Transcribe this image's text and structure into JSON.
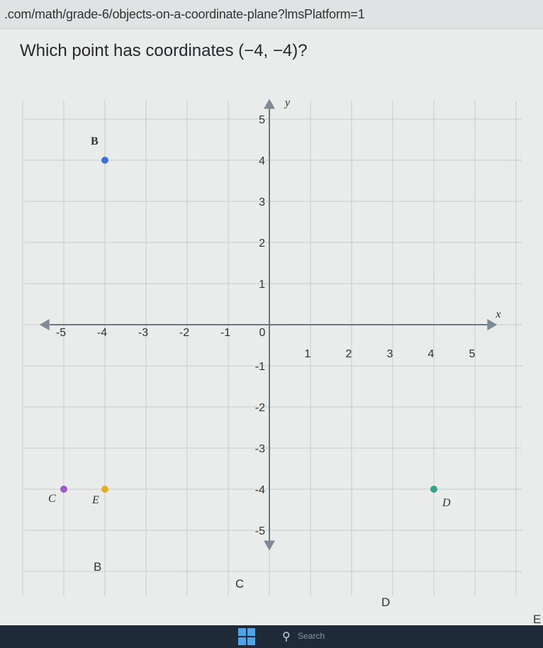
{
  "browser": {
    "url": ".com/math/grade-6/objects-on-a-coordinate-plane?lmsPlatform=1"
  },
  "question": {
    "prefix": "Which point has coordinates ",
    "coords": "(−4, −4)",
    "suffix": "?"
  },
  "plane": {
    "x_axis_label": "x",
    "y_axis_label": "y",
    "x_range": [
      -5,
      5
    ],
    "y_range": [
      -5,
      5
    ],
    "x_ticks": [
      "-5",
      "-4",
      "-3",
      "-2",
      "-1",
      "0",
      "1",
      "2",
      "3",
      "4",
      "5"
    ],
    "y_ticks": [
      "-5",
      "-4",
      "-3",
      "-2",
      "-1",
      "1",
      "2",
      "3",
      "4",
      "5"
    ],
    "points": [
      {
        "label": "B",
        "x": -4,
        "y": 4,
        "color": "#3d6fd6"
      },
      {
        "label": "C",
        "x": -5,
        "y": -4,
        "color": "#9a5bc4"
      },
      {
        "label": "E",
        "x": -4,
        "y": -4,
        "color": "#e0b020"
      },
      {
        "label": "D",
        "x": 4,
        "y": -4,
        "color": "#2fa58a"
      }
    ]
  },
  "answers": [
    {
      "label": "B"
    },
    {
      "label": "C"
    },
    {
      "label": "D"
    },
    {
      "label": "E"
    }
  ],
  "taskbar": {
    "search_label": "Search"
  },
  "colors": {
    "grid": "#c7cccd",
    "axis": "#6d7780",
    "axis_arrow": "#7f8a96"
  }
}
